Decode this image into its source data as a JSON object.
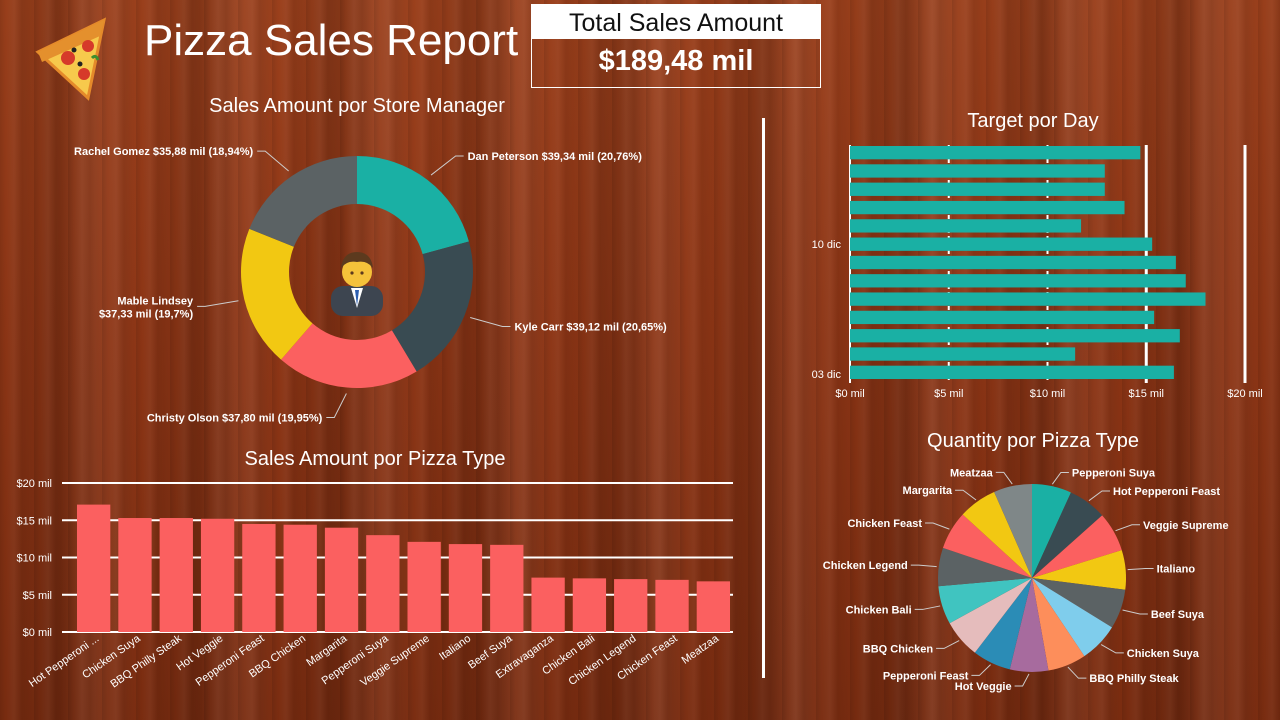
{
  "header": {
    "title": "Pizza Sales Report",
    "kpi_label": "Total Sales Amount",
    "kpi_value": "$189,48 mil"
  },
  "colors": {
    "teal": "#1ab0a4",
    "slate": "#394b52",
    "coral": "#fb6060",
    "yellow": "#f2c812",
    "grey": "#5b6264"
  },
  "chart_data": [
    {
      "type": "pie",
      "title": "Sales Amount por Store Manager",
      "labels": [
        "Dan Peterson",
        "Kyle Carr",
        "Christy Olson",
        "Mable Lindsey",
        "Rachel Gomez"
      ],
      "value_labels": [
        "$39,34 mil",
        "$39,12 mil",
        "$37,80 mil",
        "$37,33 mil",
        "$35,88 mil"
      ],
      "percent_labels": [
        "(20,76%)",
        "(20,65%)",
        "(19,95%)",
        "(19,7%)",
        "(18,94%)"
      ],
      "values": [
        39.34,
        39.12,
        37.8,
        37.33,
        35.88
      ],
      "colors": [
        "#1ab0a4",
        "#394b52",
        "#fb6060",
        "#f2c812",
        "#5b6264"
      ],
      "donut": true
    },
    {
      "type": "bar",
      "orientation": "horizontal",
      "title": "Target por Day",
      "y_tick_labels": [
        "10 dic",
        "03 dic"
      ],
      "x_tick_labels": [
        "$0 mil",
        "$5 mil",
        "$10 mil",
        "$15 mil",
        "$20 mil"
      ],
      "xlim": [
        0,
        20
      ],
      "target": 15,
      "values": [
        14.7,
        12.9,
        12.9,
        13.9,
        11.7,
        15.3,
        16.5,
        17.0,
        18.0,
        15.4,
        16.7,
        11.4,
        16.4
      ],
      "color": "#1ab0a4"
    },
    {
      "type": "bar",
      "title": "Sales Amount por Pizza Type",
      "categories": [
        "Hot Pepperoni ...",
        "Chicken Suya",
        "BBQ Philly Steak",
        "Hot Veggie",
        "Pepperoni Feast",
        "BBQ Chicken",
        "Margarita",
        "Pepperoni Suya",
        "Veggie Supreme",
        "Italiano",
        "Beef Suya",
        "Extravaganza",
        "Chicken Bali",
        "Chicken Legend",
        "Chicken Feast",
        "Meatzaa"
      ],
      "values": [
        17.1,
        15.3,
        15.3,
        15.2,
        14.5,
        14.4,
        14.0,
        13.0,
        12.1,
        11.8,
        11.7,
        7.3,
        7.2,
        7.1,
        7.0,
        6.8
      ],
      "y_tick_labels": [
        "$0 mil",
        "$5 mil",
        "$10 mil",
        "$15 mil",
        "$20 mil"
      ],
      "ylim": [
        0,
        20
      ],
      "color": "#fb6060"
    },
    {
      "type": "pie",
      "title": "Quantity por Pizza Type",
      "labels": [
        "Pepperoni Suya",
        "Hot Pepperoni Feast",
        "Veggie Supreme",
        "Italiano",
        "Beef Suya",
        "Chicken Suya",
        "BBQ Philly Steak",
        "Hot Veggie",
        "Pepperoni Feast",
        "BBQ Chicken",
        "Chicken Bali",
        "Chicken Legend",
        "Chicken Feast",
        "Margarita",
        "Meatzaa"
      ],
      "values": [
        6.8,
        6.6,
        6.8,
        6.8,
        6.8,
        6.8,
        6.6,
        6.6,
        6.6,
        6.6,
        6.6,
        6.6,
        6.6,
        6.6,
        6.6
      ],
      "colors": [
        "#1ab0a4",
        "#394b52",
        "#fb6060",
        "#f2c812",
        "#5b6264",
        "#7fcdec",
        "#fd8e5b",
        "#a76b9e",
        "#2b8cb6",
        "#e5bcbc",
        "#40c4c0",
        "#5b6264",
        "#fb6060",
        "#f2c812",
        "#7f8788"
      ]
    }
  ]
}
